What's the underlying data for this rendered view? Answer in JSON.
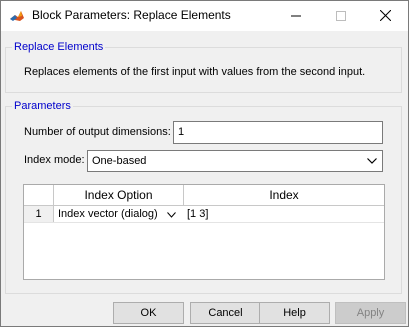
{
  "window": {
    "title": "Block Parameters: Replace Elements",
    "icon": "matlab-icon"
  },
  "group_main": {
    "legend": "Replace Elements",
    "description": "Replaces elements of the first input with values from the second input."
  },
  "group_params": {
    "legend": "Parameters",
    "num_dims_label": "Number of output dimensions:",
    "num_dims_value": "1",
    "index_mode_label": "Index mode:",
    "index_mode_value": "One-based"
  },
  "table": {
    "headers": [
      "Index Option",
      "Index"
    ],
    "rows": [
      {
        "num": "1",
        "option": "Index vector (dialog)",
        "index": "[1 3]"
      }
    ]
  },
  "buttons": {
    "ok": "OK",
    "cancel": "Cancel",
    "help": "Help",
    "apply": "Apply"
  }
}
